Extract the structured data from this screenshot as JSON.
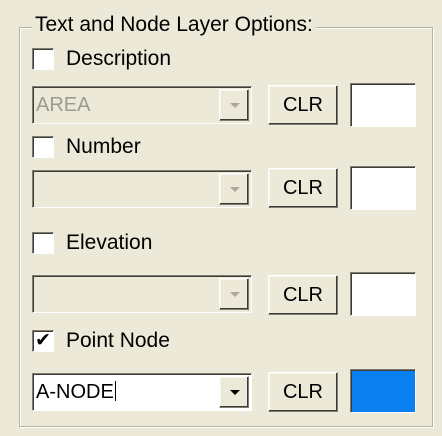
{
  "group": {
    "title": "Text and Node Layer Options:"
  },
  "rows": [
    {
      "label": "Description",
      "checked": false,
      "combo_value": "AREA",
      "combo_enabled": false,
      "clr_label": "CLR",
      "swatch_color": "#ffffff"
    },
    {
      "label": "Number",
      "checked": false,
      "combo_value": "",
      "combo_enabled": false,
      "clr_label": "CLR",
      "swatch_color": "#ffffff"
    },
    {
      "label": "Elevation",
      "checked": false,
      "combo_value": "",
      "combo_enabled": false,
      "clr_label": "CLR",
      "swatch_color": "#ffffff"
    },
    {
      "label": "Point Node",
      "checked": true,
      "combo_value": "A-NODE",
      "combo_enabled": true,
      "clr_label": "CLR",
      "swatch_color": "#0a7ff0"
    }
  ],
  "icons": {
    "check": "✔",
    "dropdown": "chevron-down-icon"
  }
}
